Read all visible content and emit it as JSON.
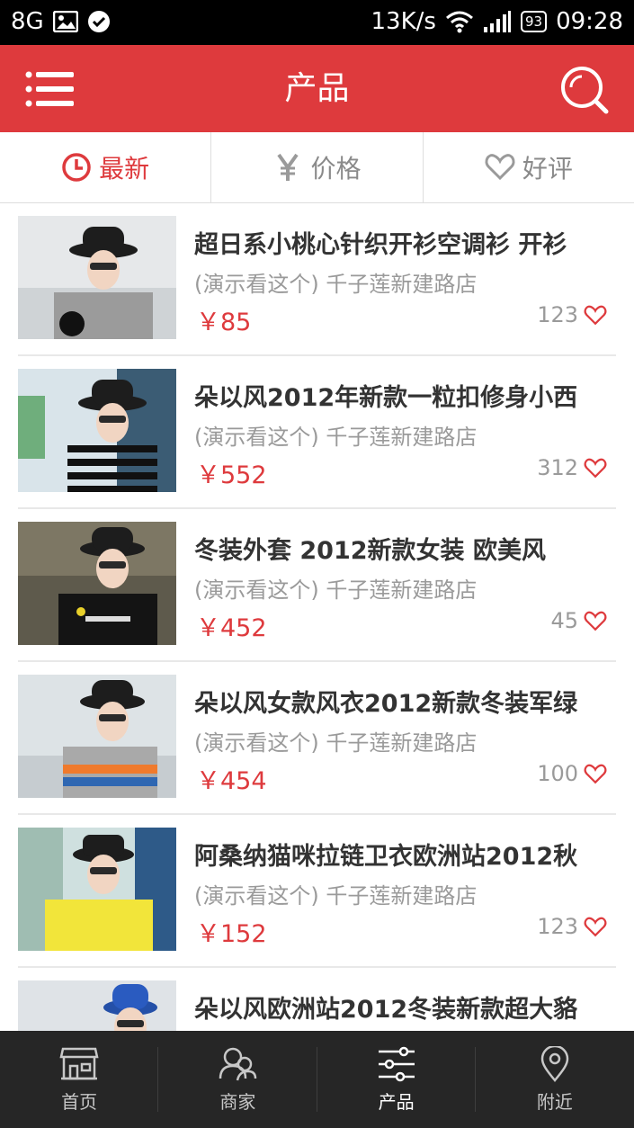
{
  "status_bar": {
    "network": "8G",
    "speed": "13K/s",
    "battery": "93",
    "time": "09:28"
  },
  "header": {
    "title": "产品"
  },
  "tabs": [
    {
      "label": "最新",
      "icon": "clock-icon",
      "active": true
    },
    {
      "label": "价格",
      "icon": "yen-icon",
      "active": false
    },
    {
      "label": "好评",
      "icon": "heart-outline-icon",
      "active": false
    }
  ],
  "products": [
    {
      "name": "超日系小桃心针织开衫空调衫 开衫",
      "shop": "(演示看这个) 千子莲新建路店",
      "price": "￥85",
      "likes": "123"
    },
    {
      "name": "朵以风2012年新款一粒扣修身小西",
      "shop": "(演示看这个) 千子莲新建路店",
      "price": "￥552",
      "likes": "312"
    },
    {
      "name": "冬装外套 2012新款女装 欧美风",
      "shop": "(演示看这个) 千子莲新建路店",
      "price": "￥452",
      "likes": "45"
    },
    {
      "name": "朵以风女款风衣2012新款冬装军绿",
      "shop": "(演示看这个) 千子莲新建路店",
      "price": "￥454",
      "likes": "100"
    },
    {
      "name": "阿桑纳猫咪拉链卫衣欧洲站2012秋",
      "shop": "(演示看这个) 千子莲新建路店",
      "price": "￥152",
      "likes": "123"
    },
    {
      "name": "朵以风欧洲站2012冬装新款超大貉",
      "shop": "",
      "price": "",
      "likes": ""
    }
  ],
  "bottom_nav": [
    {
      "label": "首页",
      "icon": "storefront-icon",
      "active": false
    },
    {
      "label": "商家",
      "icon": "merchants-icon",
      "active": false
    },
    {
      "label": "产品",
      "icon": "sliders-icon",
      "active": true
    },
    {
      "label": "附近",
      "icon": "location-pin-icon",
      "active": false
    }
  ],
  "colors": {
    "accent": "#de3a3d",
    "nav_bg": "#262626"
  }
}
